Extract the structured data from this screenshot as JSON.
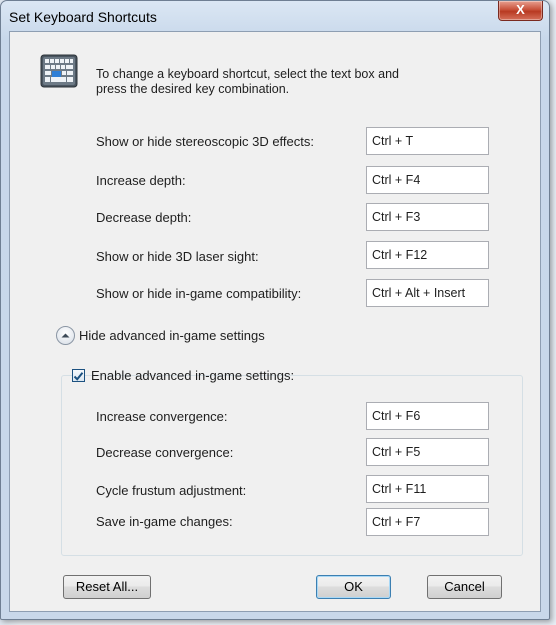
{
  "window": {
    "title": "Set Keyboard Shortcuts",
    "close_glyph": "X"
  },
  "intro": {
    "line1": "To change a keyboard shortcut, select the text box and",
    "line2": "press the desired key combination.",
    "icon": "keyboard-icon"
  },
  "shortcuts": [
    {
      "label": "Show or hide stereoscopic 3D effects:",
      "value": "Ctrl + T"
    },
    {
      "label": "Increase depth:",
      "value": "Ctrl + F4"
    },
    {
      "label": "Decrease depth:",
      "value": "Ctrl + F3"
    },
    {
      "label": "Show or hide 3D laser sight:",
      "value": "Ctrl + F12"
    },
    {
      "label": "Show or hide in-game compatibility:",
      "value": "Ctrl + Alt + Insert"
    }
  ],
  "advanced": {
    "toggle_label": "Hide advanced in-game settings",
    "enable_label": "Enable advanced in-game settings:",
    "enabled": true,
    "shortcuts": [
      {
        "label": "Increase convergence:",
        "value": "Ctrl + F6"
      },
      {
        "label": "Decrease convergence:",
        "value": "Ctrl + F5"
      },
      {
        "label": "Cycle frustum adjustment:",
        "value": "Ctrl + F11"
      },
      {
        "label": "Save in-game changes:",
        "value": "Ctrl + F7"
      }
    ]
  },
  "buttons": {
    "reset": "Reset All...",
    "ok": "OK",
    "cancel": "Cancel"
  },
  "colors": {
    "close_button": "#c8513a",
    "default_button_border": "#3c7fb1",
    "checkbox_check": "#1c5180"
  }
}
